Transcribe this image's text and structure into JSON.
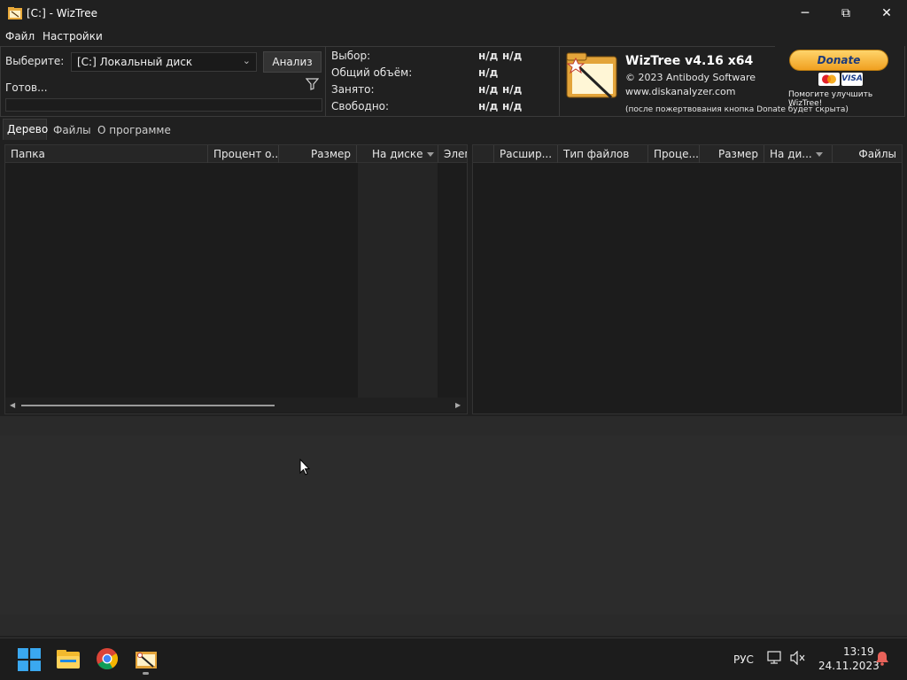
{
  "window": {
    "title": "[C:]  - WizTree",
    "minimize_glyph": "─",
    "maximize_glyph": "⧉",
    "close_glyph": "✕"
  },
  "menu": {
    "file": "Файл",
    "settings": "Настройки"
  },
  "scan": {
    "select_label": "Выберите:",
    "drive_value": "[C:] Локальный диск",
    "analyze_button": "Анализ",
    "status_text": "Готов..."
  },
  "stats": {
    "rows": [
      {
        "label": "Выбор:",
        "v1": "н/д",
        "v2": "н/д"
      },
      {
        "label": "Общий объём:",
        "v1": "н/д",
        "v2": ""
      },
      {
        "label": "Занято:",
        "v1": "н/д",
        "v2": "н/д"
      },
      {
        "label": "Свободно:",
        "v1": "н/д",
        "v2": "н/д"
      }
    ]
  },
  "about": {
    "product": "WizTree v4.16 x64",
    "copyright": "© 2023 Antibody Software",
    "website": "www.diskanalyzer.com",
    "donate_note": "(после пожертвования кнопка Donate будет скрыта)",
    "donate_button": "Donate",
    "help_text": "Помогите улучшить WizTree!",
    "card_visa": "VISA"
  },
  "tabs": {
    "tree": "Дерево",
    "files": "Файлы",
    "about": "О программе"
  },
  "tree_table": {
    "columns": [
      "Папка",
      "Процент о...",
      "Размер",
      "На диске",
      "Элем"
    ]
  },
  "ext_table": {
    "columns": [
      "Расшир...",
      "Тип файлов",
      "Проце...",
      "Размер",
      "На ди...",
      "Файлы"
    ]
  },
  "taskbar": {
    "language": "РУС",
    "time": "13:19",
    "date": "24.11.2023"
  },
  "colors": {
    "background": "#202020",
    "panel": "#1c1c1c",
    "donate_orange": "#f5a623"
  }
}
